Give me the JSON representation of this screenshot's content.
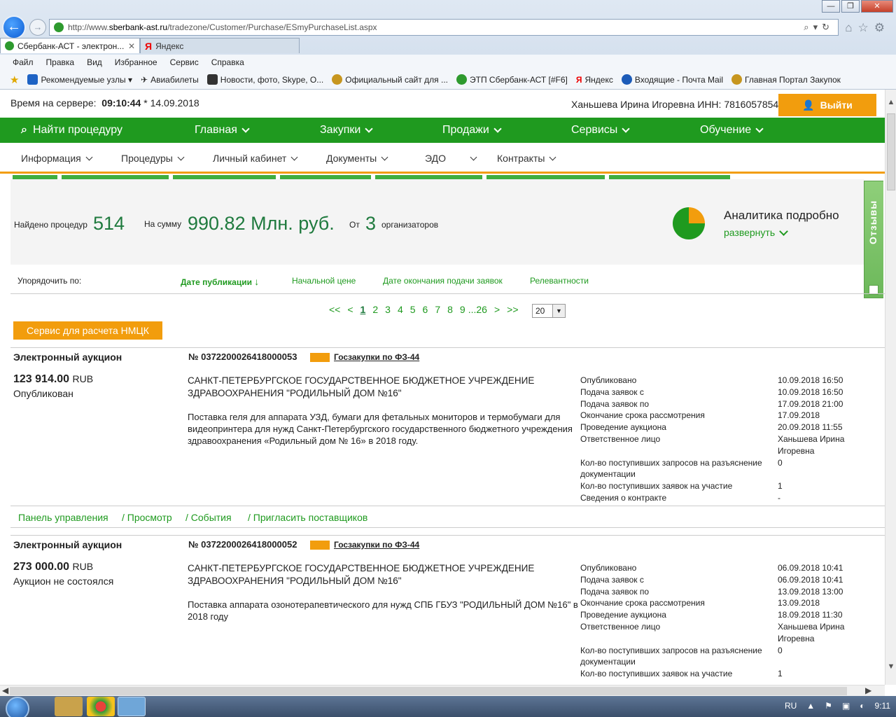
{
  "browser": {
    "url_prefix": "http://www.",
    "url_domain": "sberbank-ast.ru",
    "url_path": "/tradezone/Customer/Purchase/ESmyPurchaseList.aspx",
    "tabs": [
      {
        "title": "Сбербанк-АСТ - электрон..."
      },
      {
        "title": "Яндекс"
      }
    ],
    "menu": [
      "Файл",
      "Правка",
      "Вид",
      "Избранное",
      "Сервис",
      "Справка"
    ],
    "favorites": [
      "Рекомендуемые узлы ▾",
      "Авиабилеты",
      "Новости, фото, Skype, О...",
      "Официальный сайт для ...",
      "ЭТП Сбербанк-АСТ [#F6]",
      "Яндекс",
      "Входящие - Почта Mail",
      "Главная Портал Закупок"
    ]
  },
  "header": {
    "server_time_label": "Время на сервере:",
    "server_time": "09:10:44",
    "server_date": "* 14.09.2018",
    "user": "Ханьшева Ирина Игоревна ИНН: 7816057854",
    "exit_label": "Выйти"
  },
  "mainnav": [
    "Найти процедуру",
    "Главная",
    "Закупки",
    "Продажи",
    "Сервисы",
    "Обучение"
  ],
  "subnav": [
    "Информация",
    "Процедуры",
    "Личный кабинет",
    "Документы",
    "ЭДО",
    "Контракты"
  ],
  "stats": {
    "found_label": "Найдено процедур",
    "found_value": "514",
    "sum_label": "На сумму",
    "sum_value": "990.82 Млн. руб.",
    "from_label": "От",
    "from_value": "3",
    "org_label": "организаторов",
    "analytics_title": "Аналитика подробно",
    "analytics_expand": "развернуть"
  },
  "feedback_label": "Отзывы",
  "sort": {
    "label": "Упорядочить по:",
    "options": [
      "Дате публикации",
      "Начальной цене",
      "Дате окончания подачи заявок",
      "Релевантности"
    ],
    "active_arrow": "↓"
  },
  "pager": {
    "items": [
      "<<",
      "<",
      "1",
      "2",
      "3",
      "4",
      "5",
      "6",
      "7",
      "8",
      "9",
      "...26",
      ">",
      ">>"
    ],
    "per_page": "20"
  },
  "nmck_button": "Сервис для расчета НМЦК",
  "procedures": [
    {
      "kind": "Электронный аукцион",
      "number": "№ 0372200026418000053",
      "law": "Госзакупки по ФЗ-44",
      "price": "123 914.00",
      "currency": "RUB",
      "status": "Опубликован",
      "org": "САНКТ-ПЕТЕРБУРГСКОЕ ГОСУДАРСТВЕННОЕ БЮДЖЕТНОЕ УЧРЕЖДЕНИЕ ЗДРАВООХРАНЕНИЯ \"РОДИЛЬНЫЙ ДОМ №16\"",
      "desc": "Поставка геля для аппарата УЗД, бумаги для фетальных мониторов и термобумаги для видеопринтера для нужд Санкт-Петербургского государственного бюджетного учреждения здравоохранения «Родильный дом № 16» в 2018 году.",
      "info": [
        [
          "Опубликовано",
          "10.09.2018 16:50"
        ],
        [
          "Подача заявок с",
          "10.09.2018 16:50"
        ],
        [
          "Подача заявок по",
          "17.09.2018 21:00"
        ],
        [
          "Окончание срока рассмотрения",
          "17.09.2018"
        ],
        [
          "Проведение аукциона",
          "20.09.2018 11:55"
        ],
        [
          "Ответственное лицо",
          "Ханьшева Ирина Игоревна"
        ],
        [
          "Кол-во поступивших запросов на разъяснение документации",
          "0"
        ],
        [
          "Кол-во поступивших заявок на участие",
          "1"
        ],
        [
          "Сведения о контракте",
          "-"
        ]
      ]
    },
    {
      "kind": "Электронный аукцион",
      "number": "№ 0372200026418000052",
      "law": "Госзакупки по ФЗ-44",
      "price": "273 000.00",
      "currency": "RUB",
      "status": "Аукцион не состоялся",
      "org": "САНКТ-ПЕТЕРБУРГСКОЕ ГОСУДАРСТВЕННОЕ БЮДЖЕТНОЕ УЧРЕЖДЕНИЕ ЗДРАВООХРАНЕНИЯ \"РОДИЛЬНЫЙ ДОМ №16\"",
      "desc": "Поставка аппарата озонотерапевтического для нужд СПБ ГБУЗ \"РОДИЛЬНЫЙ ДОМ №16\" в 2018 году",
      "info": [
        [
          "Опубликовано",
          "06.09.2018 10:41"
        ],
        [
          "Подача заявок с",
          "06.09.2018 10:41"
        ],
        [
          "Подача заявок по",
          "13.09.2018 13:00"
        ],
        [
          "Окончание срока рассмотрения",
          "13.09.2018"
        ],
        [
          "Проведение аукциона",
          "18.09.2018 11:30"
        ],
        [
          "Ответственное лицо",
          "Ханьшева Ирина Игоревна"
        ],
        [
          "Кол-во поступивших запросов на разъяснение документации",
          "0"
        ],
        [
          "Кол-во поступивших заявок на участие",
          "1"
        ]
      ]
    }
  ],
  "actions": [
    "Панель управления",
    "/ Просмотр",
    "/  События",
    "/ Пригласить поставщиков"
  ],
  "taskbar": {
    "lang": "RU",
    "time": "9:11"
  },
  "colors": {
    "brand_green": "#1f9a1f",
    "accent_orange": "#f29d0d"
  }
}
